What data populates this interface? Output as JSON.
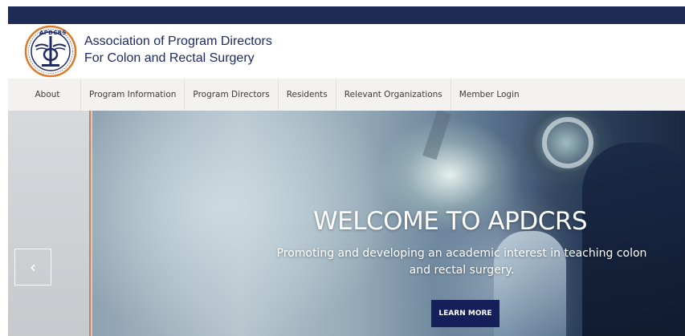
{
  "header": {
    "logo_text": "APDCRS",
    "site_name_line1": "Association of Program Directors",
    "site_name_line2": "For Colon and Rectal Surgery"
  },
  "nav": {
    "items": [
      {
        "label": "About"
      },
      {
        "label": "Program Information"
      },
      {
        "label": "Program Directors"
      },
      {
        "label": "Residents"
      },
      {
        "label": "Relevant Organizations"
      },
      {
        "label": "Member Login"
      }
    ]
  },
  "hero": {
    "title": "WELCOME TO APDCRS",
    "subtitle": "Promoting and developing an academic interest in teaching colon and rectal surgery.",
    "cta_label": "LEARN MORE",
    "prev_icon": "‹"
  },
  "colors": {
    "topbar": "#1e2b52",
    "brand_text": "#1e2a66",
    "nav_bg": "#f3f2ef",
    "cta_bg": "#15205a",
    "logo_accent": "#e07a28"
  },
  "icons": {
    "logo": "apdcrs-seal-icon",
    "prev": "chevron-left-icon"
  }
}
